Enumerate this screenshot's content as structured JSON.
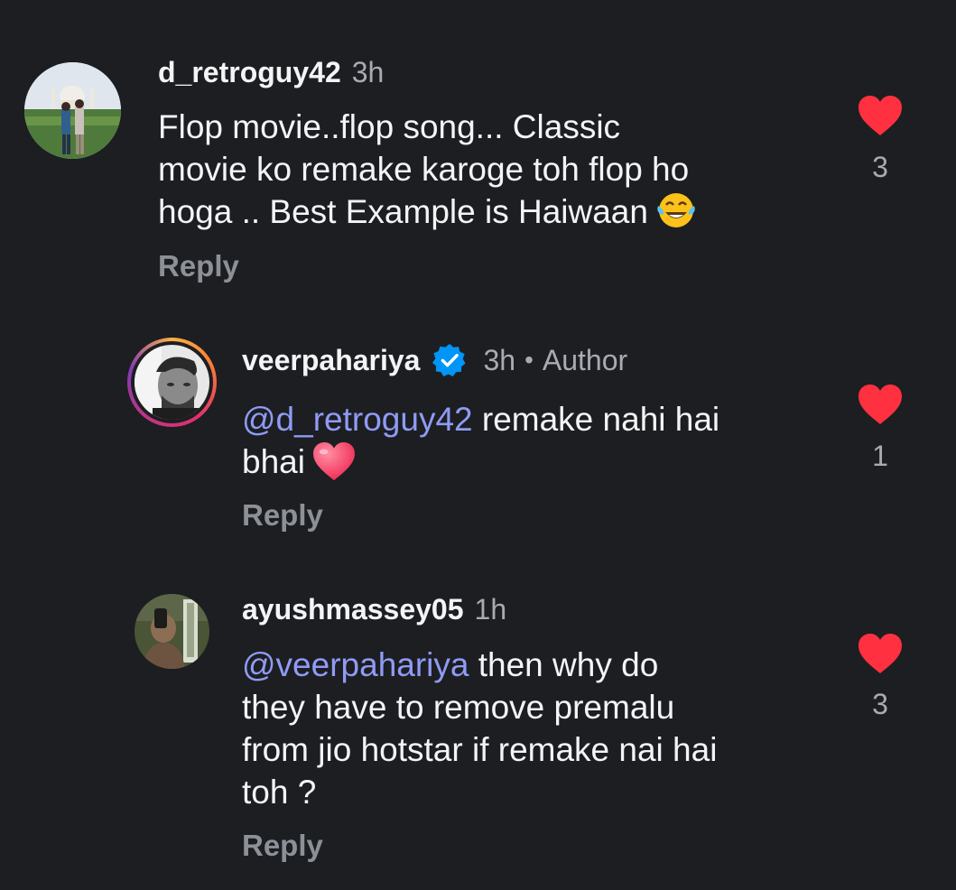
{
  "comments": [
    {
      "username": "d_retroguy42",
      "time": "3h",
      "text_lines": [
        "Flop movie..flop song... Classic",
        "movie ko remake karoge toh flop ho",
        "hoga .. Best Example is Haiwaan"
      ],
      "emoji": "face-with-tears-of-joy-icon",
      "reply_label": "Reply",
      "likes": "3"
    },
    {
      "username": "veerpahariya",
      "verified": true,
      "time": "3h",
      "separator": "•",
      "badge": "Author",
      "mention": "@d_retroguy42",
      "text_lines": [
        " remake nahi hai",
        "bhai"
      ],
      "emoji": "heart-icon",
      "reply_label": "Reply",
      "likes": "1"
    },
    {
      "username": "ayushmassey05",
      "time": "1h",
      "mention": "@veerpahariya",
      "text_lines": [
        " then why do",
        "they have to remove premalu",
        "from jio hotstar if remake nai hai",
        "toh ?"
      ],
      "reply_label": "Reply",
      "likes": "3"
    }
  ],
  "colors": {
    "background": "#1c1e21",
    "mention": "#8f9bf5",
    "like_heart": "#ff3040",
    "verified_badge": "#0095f6",
    "secondary_text": "#a8abb2"
  }
}
